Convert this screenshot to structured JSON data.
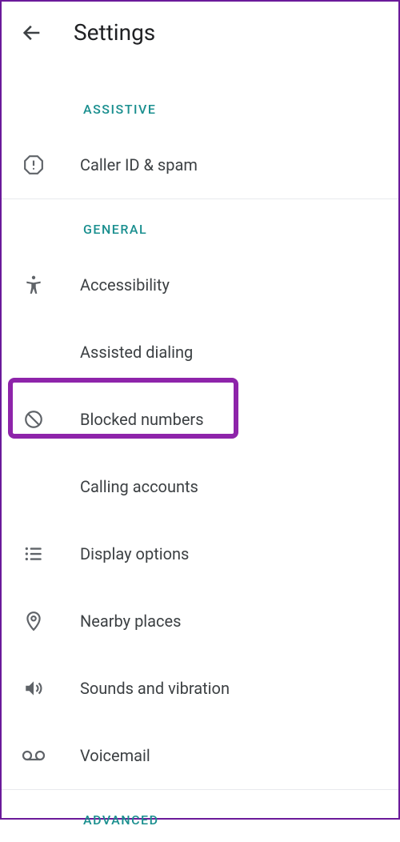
{
  "header": {
    "title": "Settings"
  },
  "sections": {
    "assistive": {
      "header": "ASSISTIVE",
      "items": {
        "caller_id": "Caller ID & spam"
      }
    },
    "general": {
      "header": "GENERAL",
      "items": {
        "accessibility": "Accessibility",
        "assisted_dialing": "Assisted dialing",
        "blocked_numbers": "Blocked numbers",
        "calling_accounts": "Calling accounts",
        "display_options": "Display options",
        "nearby_places": "Nearby places",
        "sounds_vibration": "Sounds and vibration",
        "voicemail": "Voicemail"
      }
    },
    "advanced": {
      "header": "ADVANCED"
    }
  }
}
